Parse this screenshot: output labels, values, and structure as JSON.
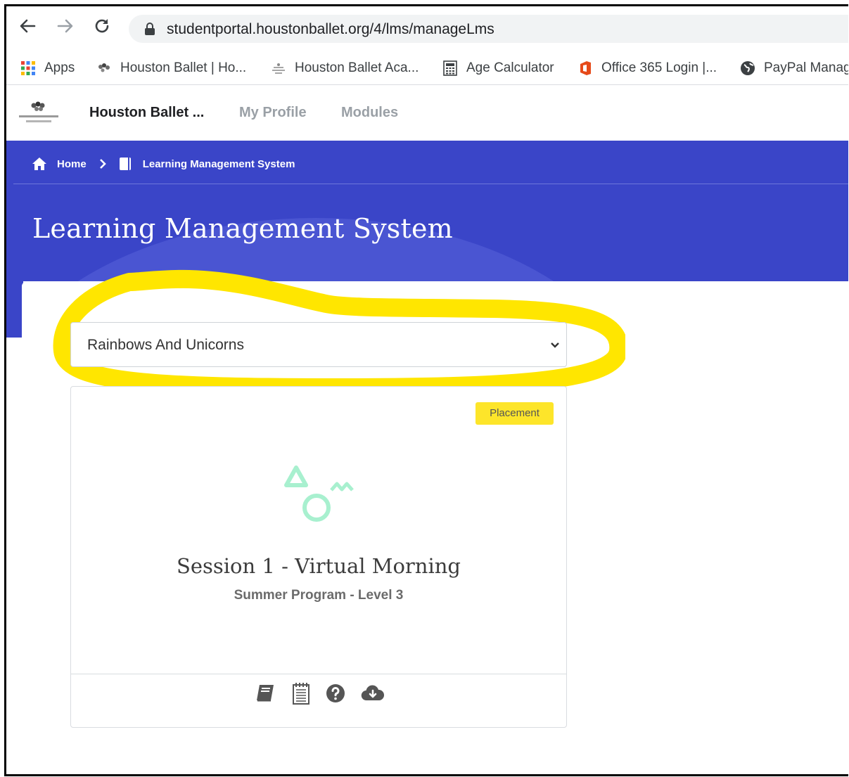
{
  "browser": {
    "url": "studentportal.houstonballet.org/4/lms/manageLms",
    "bookmarks": [
      {
        "label": "Apps",
        "icon": "apps-grid-icon"
      },
      {
        "label": "Houston Ballet | Ho...",
        "icon": "houston-ballet-icon"
      },
      {
        "label": "Houston Ballet Aca...",
        "icon": "academy-icon"
      },
      {
        "label": "Age Calculator",
        "icon": "calculator-icon"
      },
      {
        "label": "Office 365 Login |...",
        "icon": "office-icon"
      },
      {
        "label": "PayPal Manag",
        "icon": "globe-icon"
      }
    ]
  },
  "app_nav": {
    "brand": "Houston Ballet ...",
    "items": [
      "My Profile",
      "Modules"
    ]
  },
  "breadcrumb": {
    "home": "Home",
    "current": "Learning Management System"
  },
  "page": {
    "title": "Learning Management System"
  },
  "selector": {
    "value": "Rainbows And Unicorns"
  },
  "course_card": {
    "badge": "Placement",
    "title": "Session 1 - Virtual Morning",
    "subtitle": "Summer Program - Level 3",
    "footer_icons": [
      "book-icon",
      "notepad-icon",
      "help-icon",
      "cloud-download-icon"
    ]
  },
  "colors": {
    "banner": "#3a45c8",
    "highlight": "#ffe600",
    "badge": "#fde52a",
    "art": "#a8f0cf"
  }
}
